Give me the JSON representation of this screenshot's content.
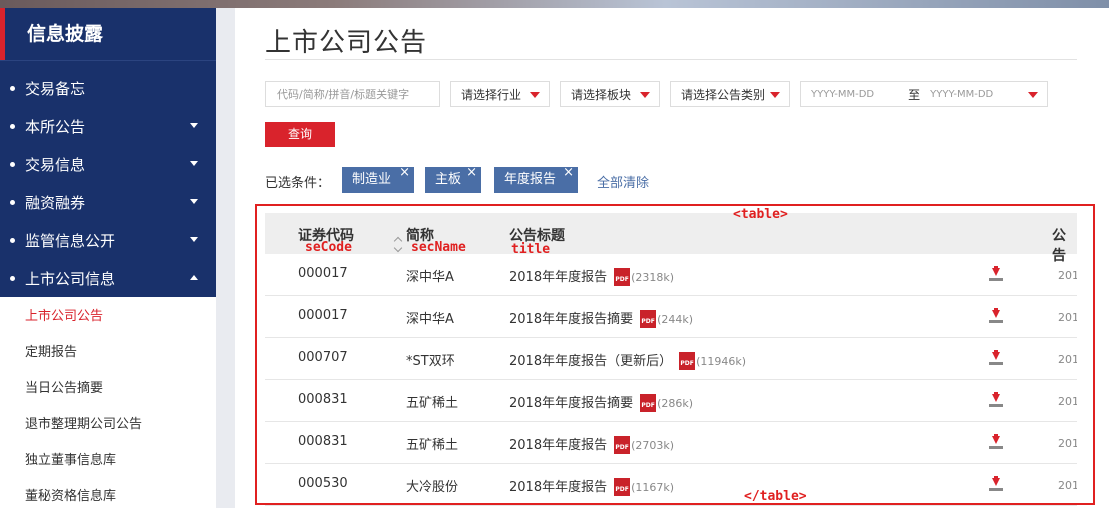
{
  "sidebar": {
    "title": "信息披露",
    "nav": [
      {
        "label": "交易备忘",
        "caret": "none"
      },
      {
        "label": "本所公告",
        "caret": "down"
      },
      {
        "label": "交易信息",
        "caret": "down"
      },
      {
        "label": "融资融券",
        "caret": "down"
      },
      {
        "label": "监管信息公开",
        "caret": "down"
      },
      {
        "label": "上市公司信息",
        "caret": "up"
      }
    ],
    "sub": [
      {
        "label": "上市公司公告",
        "active": true
      },
      {
        "label": "定期报告",
        "active": false
      },
      {
        "label": "当日公告摘要",
        "active": false
      },
      {
        "label": "退市整理期公司公告",
        "active": false
      },
      {
        "label": "独立董事信息库",
        "active": false
      },
      {
        "label": "董秘资格信息库",
        "active": false
      }
    ]
  },
  "main": {
    "title": "上市公司公告",
    "filters": {
      "keyword_placeholder": "代码/简称/拼音/标题关键字",
      "industry": "请选择行业",
      "board": "请选择板块",
      "category": "请选择公告类别",
      "date_start": "YYYY-MM-DD",
      "date_sep": "至",
      "date_end": "YYYY-MM-DD"
    },
    "query_label": "查询",
    "conditions_label": "已选条件：",
    "tags": [
      "制造业",
      "主板",
      "年度报告"
    ],
    "tag_close": "×",
    "clear_all": "全部清除",
    "table": {
      "headers": [
        "证券代码",
        "简称",
        "公告标题",
        "公告"
      ],
      "pdf_label": "PDF",
      "rows": [
        {
          "code": "000017",
          "name": "深中华A",
          "title": "2018年年度报告",
          "size": "(2318k)",
          "date": "201"
        },
        {
          "code": "000017",
          "name": "深中华A",
          "title": "2018年年度报告摘要",
          "size": "(244k)",
          "date": "201"
        },
        {
          "code": "000707",
          "name": "*ST双环",
          "title": "2018年年度报告（更新后）",
          "size": "(11946k)",
          "date": "201"
        },
        {
          "code": "000831",
          "name": "五矿稀土",
          "title": "2018年年度报告摘要",
          "size": "(286k)",
          "date": "201"
        },
        {
          "code": "000831",
          "name": "五矿稀土",
          "title": "2018年年度报告",
          "size": "(2703k)",
          "date": "201"
        },
        {
          "code": "000530",
          "name": "大冷股份",
          "title": "2018年年度报告",
          "size": "(1167k)",
          "date": "201"
        }
      ]
    }
  },
  "annotations": {
    "table_open": "<table>",
    "table_close": "</table>",
    "seCode": "seCode",
    "secName": "secName",
    "title": "title"
  },
  "colors": {
    "accent": "#d9232c",
    "nav_bg": "#19316b",
    "tag_bg": "#4a6ea6",
    "annotation": "#e02020"
  }
}
